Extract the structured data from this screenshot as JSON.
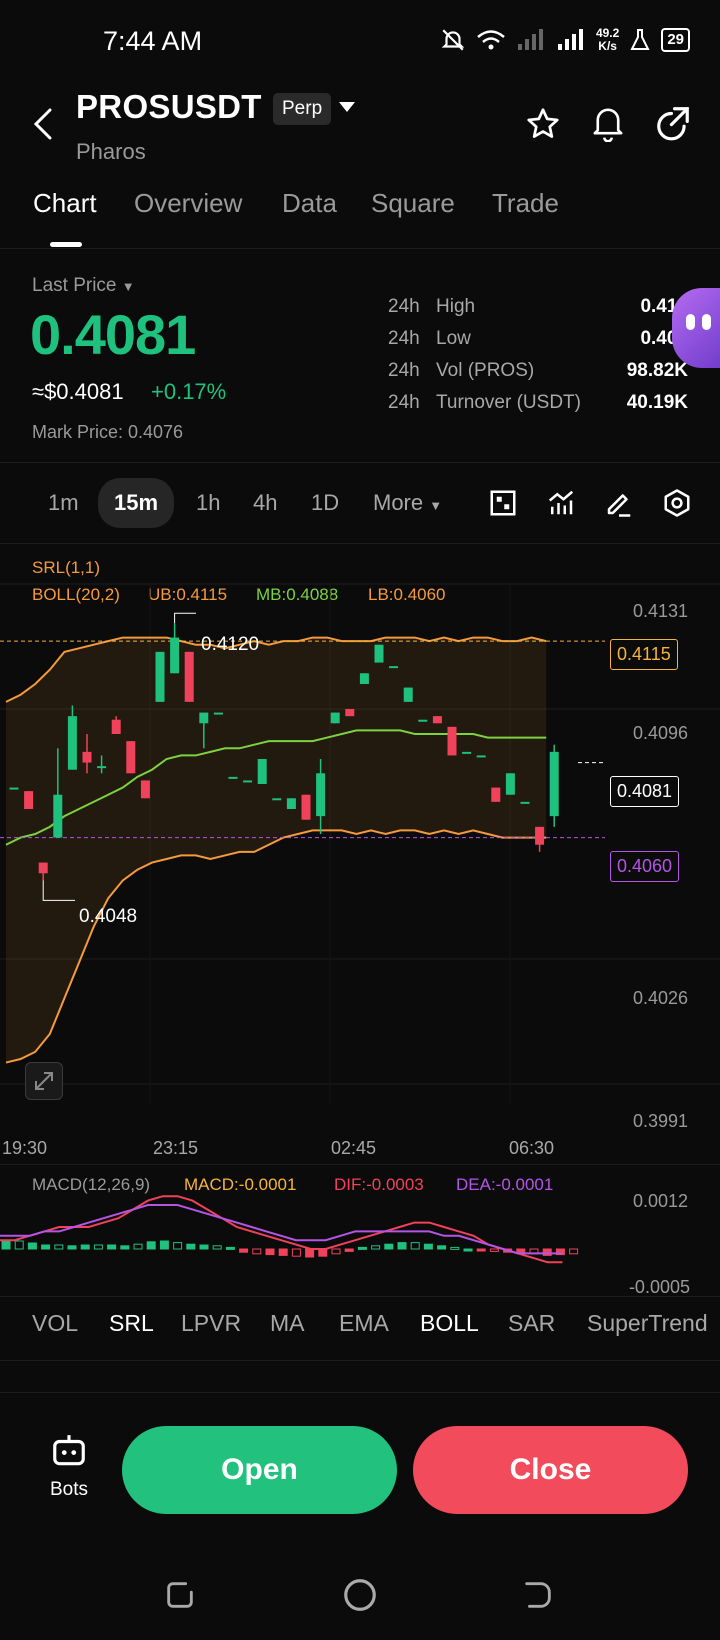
{
  "status_bar": {
    "time": "7:44 AM",
    "net_speed_top": "49.2",
    "net_speed_unit": "K/s",
    "battery": "29"
  },
  "header": {
    "symbol": "PROSUSDT",
    "badge": "Perp",
    "name": "Pharos"
  },
  "tabs": [
    "Chart",
    "Overview",
    "Data",
    "Square",
    "Trade"
  ],
  "active_tab": "Chart",
  "price": {
    "label": "Last Price",
    "last": "0.4081",
    "usd": "≈$0.4081",
    "change": "+0.17%",
    "mark": "Mark Price: 0.4076"
  },
  "stats": [
    {
      "period": "24h",
      "key": "High",
      "value": "0.412"
    },
    {
      "period": "24h",
      "key": "Low",
      "value": "0.400"
    },
    {
      "period": "24h",
      "key": "Vol (PROS)",
      "value": "98.82K"
    },
    {
      "period": "24h",
      "key": "Turnover (USDT)",
      "value": "40.19K"
    }
  ],
  "intervals": [
    "1m",
    "15m",
    "1h",
    "4h",
    "1D",
    "More"
  ],
  "selected_interval": "15m",
  "chart_indicators": {
    "srl": "SRL(1,1)",
    "boll": "BOLL(20,2)",
    "ub": "UB:0.4115",
    "mb": "MB:0.4088",
    "lb": "LB:0.4060"
  },
  "price_tags": {
    "ub": "0.4115",
    "last": "0.4081",
    "lb": "0.4060",
    "high_marker": "0.4120",
    "low_marker": "0.4048"
  },
  "y_axis": [
    "0.4131",
    "0.4096",
    "0.4026",
    "0.3991"
  ],
  "x_axis": [
    "19:30",
    "23:15",
    "02:45",
    "06:30"
  ],
  "macd": {
    "label": "MACD(12,26,9)",
    "macd": "MACD:-0.0001",
    "dif": "DIF:-0.0003",
    "dea": "DEA:-0.0001",
    "axis_top": "0.0012",
    "axis_bottom": "-0.0005"
  },
  "indicator_tabs": [
    "VOL",
    "SRL",
    "LPVR",
    "MA",
    "EMA",
    "BOLL",
    "SAR",
    "SuperTrend"
  ],
  "bottom": {
    "bots": "Bots",
    "open": "Open",
    "close": "Close"
  },
  "colors": {
    "up": "#1fc17e",
    "down": "#f0425a",
    "boll_band": "#f59b3c",
    "mid": "#7cd33f",
    "lb_tag": "#b455e6",
    "ub_tag": "#f5b43c",
    "open_btn": "#22c27e",
    "close_btn": "#f24c5c"
  },
  "chart_data": {
    "type": "candlestick",
    "y_range": [
      0.3991,
      0.4131
    ],
    "x_ticks": [
      "19:30",
      "23:15",
      "02:45",
      "06:30"
    ],
    "candles": [
      {
        "o": 0.4074,
        "c": 0.4074,
        "h": 0.4074,
        "l": 0.4074
      },
      {
        "o": 0.4073,
        "c": 0.4068,
        "h": 0.4073,
        "l": 0.4068
      },
      {
        "o": 0.4053,
        "c": 0.405,
        "h": 0.4053,
        "l": 0.4048
      },
      {
        "o": 0.406,
        "c": 0.4072,
        "h": 0.4085,
        "l": 0.406
      },
      {
        "o": 0.4079,
        "c": 0.4094,
        "h": 0.4097,
        "l": 0.4079
      },
      {
        "o": 0.4084,
        "c": 0.4081,
        "h": 0.4089,
        "l": 0.4078
      },
      {
        "o": 0.408,
        "c": 0.408,
        "h": 0.4083,
        "l": 0.4078
      },
      {
        "o": 0.4093,
        "c": 0.4089,
        "h": 0.4094,
        "l": 0.4089
      },
      {
        "o": 0.4087,
        "c": 0.4078,
        "h": 0.4087,
        "l": 0.4078
      },
      {
        "o": 0.4076,
        "c": 0.4071,
        "h": 0.4076,
        "l": 0.4071
      },
      {
        "o": 0.4098,
        "c": 0.4112,
        "h": 0.4112,
        "l": 0.4098
      },
      {
        "o": 0.4106,
        "c": 0.4116,
        "h": 0.412,
        "l": 0.4106
      },
      {
        "o": 0.4112,
        "c": 0.4098,
        "h": 0.4112,
        "l": 0.4098
      },
      {
        "o": 0.4092,
        "c": 0.4095,
        "h": 0.4095,
        "l": 0.4085
      },
      {
        "o": 0.4095,
        "c": 0.4095,
        "h": 0.4095,
        "l": 0.4095
      },
      {
        "o": 0.4077,
        "c": 0.4077,
        "h": 0.4077,
        "l": 0.4077
      },
      {
        "o": 0.4076,
        "c": 0.4076,
        "h": 0.4076,
        "l": 0.4076
      },
      {
        "o": 0.4075,
        "c": 0.4082,
        "h": 0.4082,
        "l": 0.4075
      },
      {
        "o": 0.4071,
        "c": 0.4071,
        "h": 0.4071,
        "l": 0.4071
      },
      {
        "o": 0.4068,
        "c": 0.4071,
        "h": 0.4071,
        "l": 0.4068
      },
      {
        "o": 0.4072,
        "c": 0.4065,
        "h": 0.4072,
        "l": 0.4065
      },
      {
        "o": 0.4066,
        "c": 0.4078,
        "h": 0.4082,
        "l": 0.4061
      },
      {
        "o": 0.4092,
        "c": 0.4095,
        "h": 0.4095,
        "l": 0.4092
      },
      {
        "o": 0.4096,
        "c": 0.4094,
        "h": 0.4096,
        "l": 0.4094
      },
      {
        "o": 0.4103,
        "c": 0.4106,
        "h": 0.4106,
        "l": 0.4103
      },
      {
        "o": 0.4109,
        "c": 0.4114,
        "h": 0.4114,
        "l": 0.4109
      },
      {
        "o": 0.4108,
        "c": 0.4108,
        "h": 0.4108,
        "l": 0.4108
      },
      {
        "o": 0.4098,
        "c": 0.4102,
        "h": 0.4102,
        "l": 0.4098
      },
      {
        "o": 0.4093,
        "c": 0.4093,
        "h": 0.4093,
        "l": 0.4093
      },
      {
        "o": 0.4094,
        "c": 0.4092,
        "h": 0.4094,
        "l": 0.4092
      },
      {
        "o": 0.4091,
        "c": 0.4083,
        "h": 0.4091,
        "l": 0.4083
      },
      {
        "o": 0.4084,
        "c": 0.4084,
        "h": 0.4084,
        "l": 0.4084
      },
      {
        "o": 0.4083,
        "c": 0.4083,
        "h": 0.4083,
        "l": 0.4083
      },
      {
        "o": 0.4074,
        "c": 0.407,
        "h": 0.4074,
        "l": 0.407
      },
      {
        "o": 0.4072,
        "c": 0.4078,
        "h": 0.4078,
        "l": 0.4072
      },
      {
        "o": 0.407,
        "c": 0.407,
        "h": 0.407,
        "l": 0.407
      },
      {
        "o": 0.4063,
        "c": 0.4058,
        "h": 0.4063,
        "l": 0.4056
      },
      {
        "o": 0.4066,
        "c": 0.4084,
        "h": 0.4086,
        "l": 0.4063
      }
    ],
    "boll_upper": [
      0.4098,
      0.41,
      0.4103,
      0.4107,
      0.4112,
      0.4113,
      0.4114,
      0.4115,
      0.4116,
      0.4116,
      0.4116,
      0.4116,
      0.4115,
      0.4114,
      0.4114,
      0.4113,
      0.4114,
      0.4115,
      0.4114,
      0.4115,
      0.4115,
      0.4116,
      0.4116,
      0.4115,
      0.4115,
      0.4115,
      0.4116,
      0.4116,
      0.4116,
      0.4115,
      0.4116,
      0.4115,
      0.4116,
      0.4116,
      0.4115,
      0.4115,
      0.4116,
      0.4115
    ],
    "boll_mid": [
      0.4058,
      0.406,
      0.4061,
      0.4063,
      0.4066,
      0.4068,
      0.407,
      0.4072,
      0.4074,
      0.4077,
      0.4079,
      0.4082,
      0.4083,
      0.4083,
      0.4084,
      0.4085,
      0.4085,
      0.4086,
      0.4087,
      0.4087,
      0.4087,
      0.4087,
      0.4088,
      0.4089,
      0.409,
      0.409,
      0.409,
      0.409,
      0.4089,
      0.4089,
      0.4089,
      0.4089,
      0.4089,
      0.4088,
      0.4088,
      0.4088,
      0.4088,
      0.4088
    ],
    "boll_lower": [
      0.3997,
      0.3998,
      0.4,
      0.4005,
      0.4015,
      0.4025,
      0.4035,
      0.4043,
      0.4048,
      0.4051,
      0.4053,
      0.4054,
      0.4055,
      0.4055,
      0.4054,
      0.4055,
      0.4056,
      0.4056,
      0.4058,
      0.406,
      0.4061,
      0.4062,
      0.4062,
      0.4062,
      0.4061,
      0.4062,
      0.4061,
      0.4062,
      0.4062,
      0.4061,
      0.4062,
      0.4061,
      0.4062,
      0.4061,
      0.406,
      0.406,
      0.406,
      0.406
    ],
    "macd_hist": [
      0.0002,
      0.0002,
      0.00015,
      0.0001,
      0.0001,
      8e-05,
      0.0001,
      0.0001,
      0.0001,
      8e-05,
      0.00012,
      0.00018,
      0.0002,
      0.00016,
      0.00012,
      0.0001,
      8e-05,
      4e-05,
      -8e-05,
      -0.00012,
      -0.00014,
      -0.00016,
      -0.00018,
      -0.0002,
      -0.00018,
      -0.00012,
      -6e-05,
      4e-05,
      8e-05,
      0.00012,
      0.00016,
      0.00016,
      0.00012,
      8e-05,
      4e-05,
      0.0,
      -4e-05,
      -6e-05,
      -8e-05,
      -0.0001,
      -0.00012,
      -0.00016,
      -0.00014,
      -0.00012
    ],
    "dif": [
      0.0002,
      0.0002,
      0.0003,
      0.0004,
      0.0005,
      0.0005,
      0.0005,
      0.0006,
      0.0007,
      0.0009,
      0.0011,
      0.0012,
      0.0012,
      0.0011,
      0.0009,
      0.0007,
      0.0005,
      0.0004,
      0.0003,
      0.0002,
      0.0001,
      0.0,
      0.0,
      0.0001,
      0.0002,
      0.0003,
      0.0004,
      0.0005,
      0.0006,
      0.0006,
      0.0005,
      0.0004,
      0.0003,
      0.0001,
      0.0,
      -0.0001,
      -0.0002,
      -0.0003,
      -0.0003
    ],
    "dea": [
      0.0003,
      0.0003,
      0.0003,
      0.0004,
      0.0004,
      0.0005,
      0.0006,
      0.0007,
      0.0008,
      0.0009,
      0.001,
      0.001,
      0.001,
      0.0009,
      0.0008,
      0.0007,
      0.0006,
      0.0005,
      0.0004,
      0.0003,
      0.0002,
      0.0002,
      0.0002,
      0.0003,
      0.0004,
      0.0004,
      0.0004,
      0.0004,
      0.0004,
      0.0004,
      0.0003,
      0.0003,
      0.0002,
      0.0001,
      0.0,
      -0.0001,
      -0.0001,
      -0.0001,
      -0.0001
    ]
  }
}
